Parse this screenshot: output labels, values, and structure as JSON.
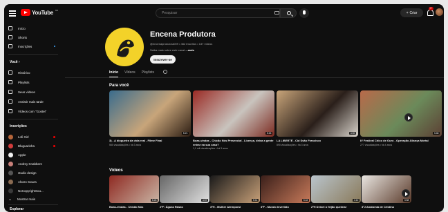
{
  "header": {
    "logo_text": "YouTube",
    "country_code": "BR",
    "search_placeholder": "Pesquisar",
    "create_label": "Criar",
    "notifications_badge": "9+"
  },
  "sidebar": {
    "main": [
      {
        "label": "Início",
        "icon": "home-icon"
      },
      {
        "label": "Shorts",
        "icon": "shorts-icon"
      },
      {
        "label": "Inscrições",
        "icon": "subscriptions-icon"
      }
    ],
    "you_heading": "Você",
    "you": [
      {
        "label": "Histórico",
        "icon": "history-icon"
      },
      {
        "label": "Playlists",
        "icon": "playlists-icon"
      },
      {
        "label": "Seus vídeos",
        "icon": "your-videos-icon"
      },
      {
        "label": "Assistir mais tarde",
        "icon": "watch-later-icon"
      },
      {
        "label": "Vídeos com \"Gostei\"",
        "icon": "liked-icon"
      }
    ],
    "subs_heading": "Inscrições",
    "subs": [
      {
        "label": "Lofi Girl",
        "color": "#b5653a",
        "live": true
      },
      {
        "label": "Bluguarinha",
        "color": "#d23c3c",
        "live": true
      },
      {
        "label": "Apple",
        "color": "#f1f1f1",
        "live": false
      },
      {
        "label": "Andrey Knabbern",
        "color": "#c9807a",
        "live": false
      },
      {
        "label": "studio design",
        "color": "#555555",
        "live": false
      },
      {
        "label": "Alvaro Souza",
        "color": "#8a6b52",
        "live": false
      },
      {
        "label": "NoCopyrightSou...",
        "color": "#3a3a3a",
        "live": false
      }
    ],
    "show_more": "Mostrar mais",
    "explore_heading": "Explorar"
  },
  "channel": {
    "name": "Encena Produtora",
    "handle": "@encenaprodutora009",
    "subscribers": "462 inscritos",
    "videos": "137 vídeos",
    "description": "Saiba mais sobre este canal",
    "more": "...mais",
    "subscribe_label": "Inscrever-se",
    "avatar_text": "Encena Produtora"
  },
  "tabs": [
    {
      "label": "Início",
      "active": true
    },
    {
      "label": "Vídeos",
      "active": false
    },
    {
      "label": "Playlists",
      "active": false
    }
  ],
  "for_you": {
    "title": "Para você",
    "videos": [
      {
        "title": "3) - A blogueira da vida real - Filme Final",
        "meta": "560 visualizações • há 3 anos",
        "duration": "5:21",
        "colors": [
          "#3a6c8d",
          "#c8a57a",
          "#2b1c12"
        ]
      },
      {
        "title": "Boas-vindas - Chicão Nós Presencial - Licença, deixa a gente entrar na sua casa?",
        "meta": "1,1 mil visualizações • há 3 anos",
        "duration": "5:26",
        "colors": [
          "#9a2a24",
          "#c9c4be",
          "#7c2a20"
        ]
      },
      {
        "title": "LA LIBERTÉ - Cid Ssão Francisco",
        "meta": "890 visualizações • há 3 anos",
        "duration": "4:59",
        "colors": [
          "#c9a57a",
          "#2a1f1a",
          "#d9d4cc"
        ]
      },
      {
        "title": "IV Festival Chico de Ouro - Operação Aliança Mortal",
        "meta": "277 visualizações • há 4 anos",
        "duration": "3:48",
        "colors": [
          "#b86a4a",
          "#6b8a5a",
          "#5c4034"
        ]
      }
    ]
  },
  "videos_section": {
    "title": "Vídeos",
    "videos": [
      {
        "title": "Boas-vindas - Chicão Nós",
        "duration": "5:26",
        "colors": [
          "#8f2a22",
          "#c9b4a4"
        ]
      },
      {
        "title": "2ºF: Águas Rasas",
        "duration": "4:57",
        "colors": [
          "#666666",
          "#e0e0e0"
        ]
      },
      {
        "title": "3ºH - Mulher Atemporal",
        "duration": "5:11",
        "colors": [
          "#1a1a1a",
          "#c8a078"
        ]
      },
      {
        "title": "3ºF - Mundo Invertido",
        "duration": "5:42",
        "colors": [
          "#3a1f1a",
          "#c87a5a"
        ]
      },
      {
        "title": "2ºH Deixei o feijão queimar",
        "duration": "4:12",
        "colors": [
          "#b9c4cc",
          "#8a7a5a"
        ]
      },
      {
        "title": "3ºJ Anatomia de Cristina",
        "duration": "3:58",
        "colors": [
          "#e9e6e1",
          "#5a3a2a"
        ]
      }
    ]
  }
}
